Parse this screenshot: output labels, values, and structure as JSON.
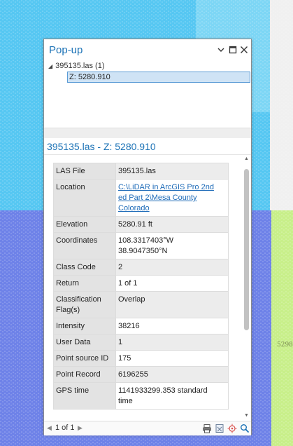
{
  "map": {
    "side_label": "5298"
  },
  "popup": {
    "title": "Pop-up",
    "tree": {
      "layer": "395135.las (1)",
      "selected": "Z: 5280.910"
    },
    "feature_title": "395135.las - Z: 5280.910",
    "attributes": {
      "las_file": {
        "key": "LAS File",
        "value": "395135.las"
      },
      "location": {
        "key": "Location",
        "value_line1": "C:\\LiDAR in ArcGIS Pro 2nd",
        "value_line2": "ed Part 2\\Mesa County",
        "value_line3": "Colorado"
      },
      "elevation": {
        "key": "Elevation",
        "value": "5280.91 ft"
      },
      "coordinates": {
        "key": "Coordinates",
        "value_line1": "108.3317403°W",
        "value_line2": "38.9047350°N"
      },
      "class_code": {
        "key": "Class Code",
        "value": "2"
      },
      "return": {
        "key": "Return",
        "value": "1 of 1"
      },
      "classification_flags": {
        "key_line1": "Classification",
        "key_line2": "Flag(s)",
        "value": "Overlap"
      },
      "intensity": {
        "key": "Intensity",
        "value": "38216"
      },
      "user_data": {
        "key": "User Data",
        "value": "1"
      },
      "point_source_id": {
        "key": "Point source ID",
        "value": "175"
      },
      "point_record": {
        "key": "Point Record",
        "value": "6196255"
      },
      "gps_time": {
        "key": "GPS time",
        "value_line1": "1141933299.353 standard",
        "value_line2": "time"
      }
    },
    "footer": {
      "count": "1 of 1"
    },
    "colors": {
      "accent": "#1b72b6",
      "selection": "#cfe3f5",
      "link": "#1e6bb8"
    }
  }
}
